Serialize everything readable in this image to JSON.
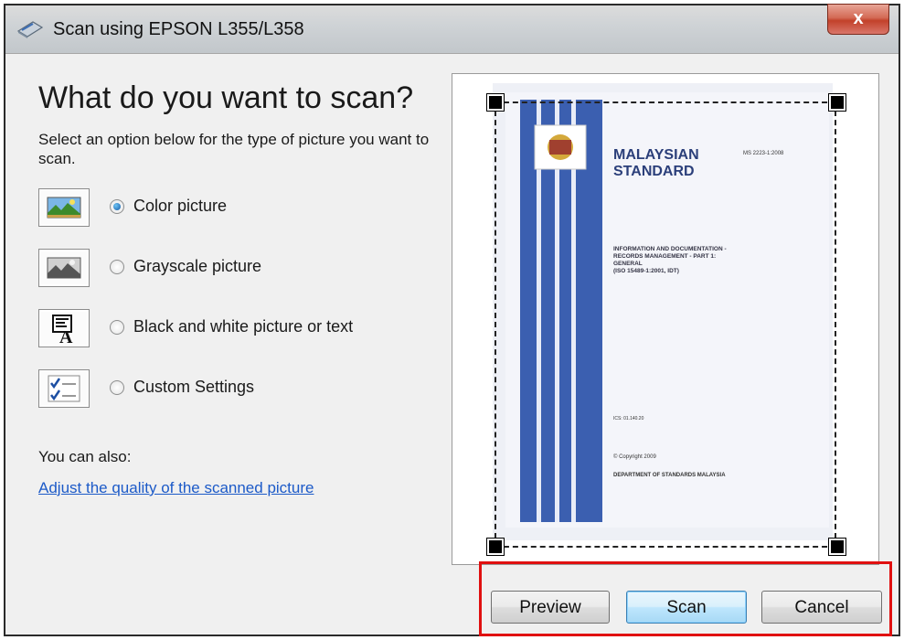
{
  "window": {
    "title": "Scan using EPSON L355/L358",
    "close_label": "x"
  },
  "heading": "What do you want to scan?",
  "subtext": "Select an option below for the type of picture you want to scan.",
  "options": [
    {
      "label": "Color picture",
      "icon": "color-picture-icon",
      "checked": true
    },
    {
      "label": "Grayscale picture",
      "icon": "grayscale-picture-icon",
      "checked": false
    },
    {
      "label": "Black and white picture or text",
      "icon": "black-white-text-icon",
      "checked": false
    },
    {
      "label": "Custom Settings",
      "icon": "custom-settings-icon",
      "checked": false
    }
  ],
  "also_label": "You can also:",
  "quality_link": "Adjust the quality of the scanned picture",
  "preview_doc": {
    "title_line1": "MALAYSIAN",
    "title_line2": "STANDARD",
    "code": "MS 2223-1:2008",
    "subject_line1": "INFORMATION AND DOCUMENTATION -",
    "subject_line2": "RECORDS MANAGEMENT - PART 1:",
    "subject_line3": "GENERAL",
    "subject_line4": "(ISO 15489-1:2001, IDT)",
    "ics": "ICS: 01.140.20",
    "copyright": "© Copyright 2009",
    "department": "DEPARTMENT OF STANDARDS MALAYSIA"
  },
  "buttons": {
    "preview": "Preview",
    "scan": "Scan",
    "cancel": "Cancel"
  },
  "colors": {
    "link": "#1c5ac8",
    "highlight_border": "#e01010",
    "doc_stripe": "#3b5fb0"
  }
}
